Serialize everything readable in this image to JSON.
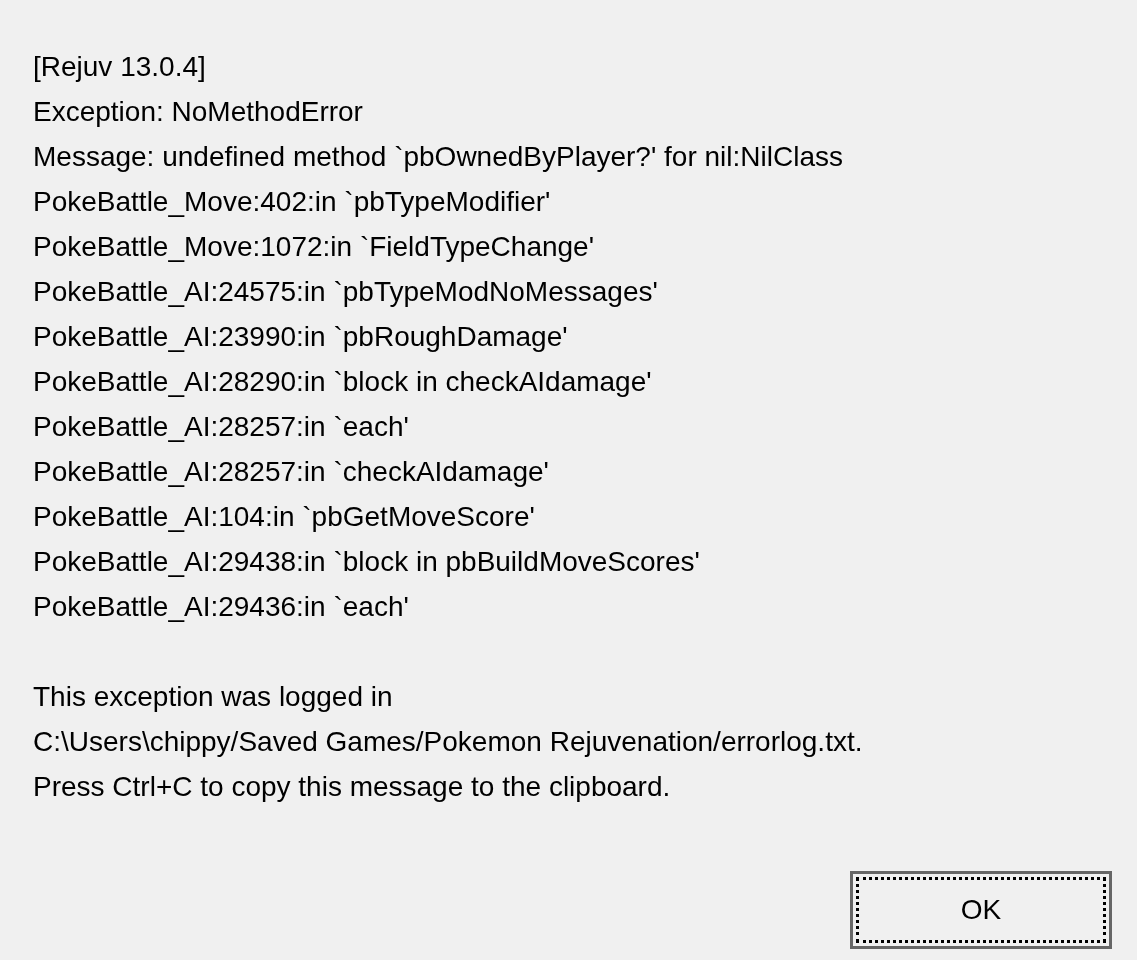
{
  "message_lines": [
    "[Rejuv 13.0.4]",
    "Exception: NoMethodError",
    "Message: undefined method `pbOwnedByPlayer?' for nil:NilClass",
    "PokeBattle_Move:402:in `pbTypeModifier'",
    "PokeBattle_Move:1072:in `FieldTypeChange'",
    "PokeBattle_AI:24575:in `pbTypeModNoMessages'",
    "PokeBattle_AI:23990:in `pbRoughDamage'",
    "PokeBattle_AI:28290:in `block in checkAIdamage'",
    "PokeBattle_AI:28257:in `each'",
    "PokeBattle_AI:28257:in `checkAIdamage'",
    "PokeBattle_AI:104:in `pbGetMoveScore'",
    "PokeBattle_AI:29438:in `block in pbBuildMoveScores'",
    "PokeBattle_AI:29436:in `each'"
  ],
  "footer_lines": [
    "This exception was logged in",
    "C:\\Users\\chippy/Saved Games/Pokemon Rejuvenation/errorlog.txt.",
    "Press Ctrl+C to copy this message to the clipboard."
  ],
  "button": {
    "label": "OK",
    "focused": true
  }
}
